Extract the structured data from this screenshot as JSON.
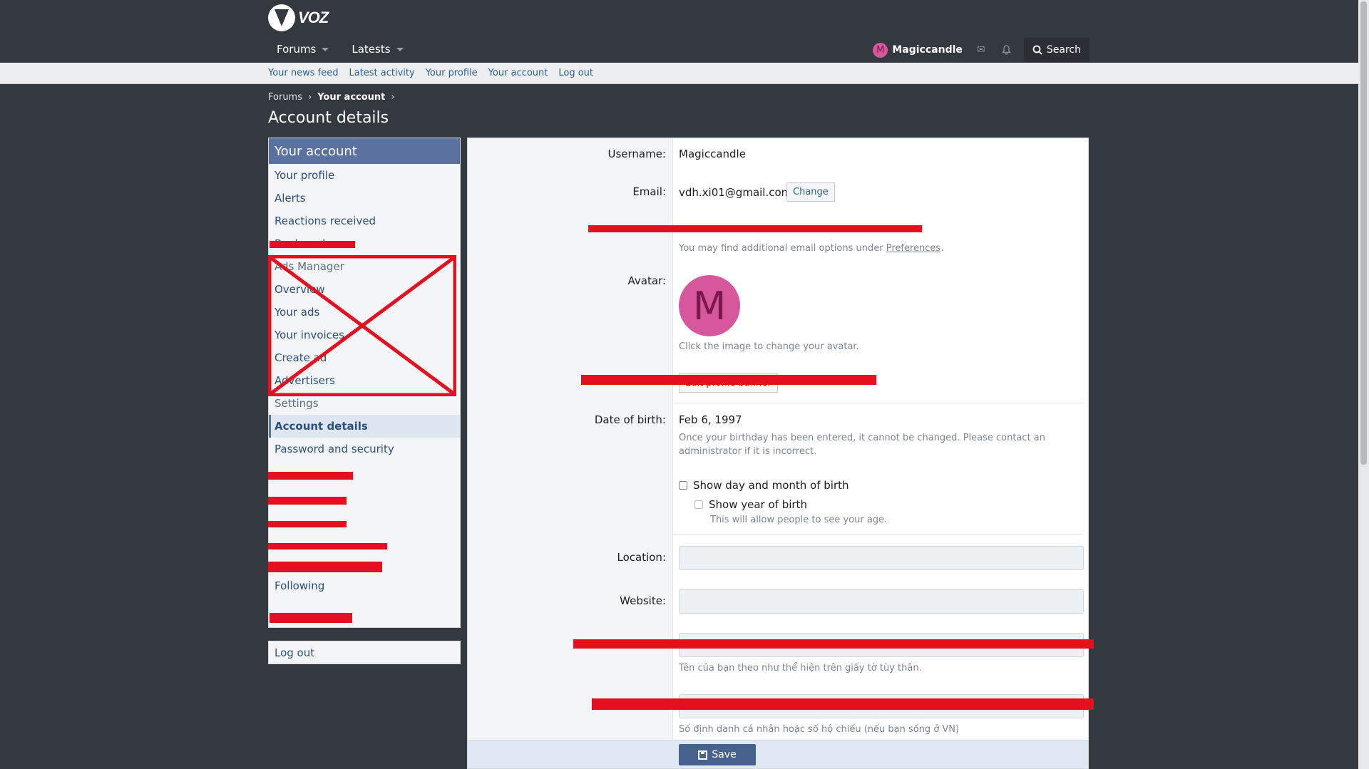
{
  "brand": {
    "logo_text": "VOZ"
  },
  "nav": {
    "forums": "Forums",
    "latests": "Latests"
  },
  "userbar": {
    "avatar_letter": "M",
    "username": "Magiccandle",
    "search": "Search"
  },
  "subnav": [
    "Your news feed",
    "Latest activity",
    "Your profile",
    "Your account",
    "Log out"
  ],
  "breadcrumb": {
    "forums": "Forums",
    "your_account": "Your account"
  },
  "page_title": "Account details",
  "sidebar": {
    "header": "Your account",
    "items": [
      {
        "label": "Your profile"
      },
      {
        "label": "Alerts"
      },
      {
        "label": "Reactions received"
      },
      {
        "label": "Bookmarks"
      },
      {
        "label": "Ads Manager"
      },
      {
        "label": "Overview"
      },
      {
        "label": "Your ads"
      },
      {
        "label": "Your invoices"
      },
      {
        "label": "Create ad"
      },
      {
        "label": "Advertisers"
      },
      {
        "label": "Settings"
      },
      {
        "label": "Account details"
      },
      {
        "label": "Password and security"
      },
      {
        "label": ""
      },
      {
        "label": ""
      },
      {
        "label": ""
      },
      {
        "label": ""
      },
      {
        "label": ""
      },
      {
        "label": "Following"
      },
      {
        "label": ""
      }
    ],
    "logout": "Log out"
  },
  "form": {
    "username_label": "Username:",
    "username_value": "Magiccandle",
    "email_label": "Email:",
    "email_value": "vdh.xi01@gmail.com",
    "change_button": "Change",
    "email_hint_prefix": "You may find additional email options under ",
    "email_hint_link": "Preferences",
    "email_hint_suffix": ".",
    "avatar_label": "Avatar:",
    "avatar_letter": "M",
    "avatar_hint": "Click the image to change your avatar.",
    "dob_label": "Date of birth:",
    "dob_value": "Feb 6, 1997",
    "dob_hint": "Once your birthday has been entered, it cannot be changed. Please contact an administrator if it is incorrect.",
    "show_day_month": "Show day and month of birth",
    "show_year": "Show year of birth",
    "show_year_hint": "This will allow people to see your age.",
    "location_label": "Location:",
    "website_label": "Website:",
    "name_hint": "Tên của bạn theo như thể hiện trên giấy tờ tùy thân.",
    "id_hint": "Số định danh cá nhân hoặc số hộ chiếu (nếu bạn sống ở VN)",
    "save_button": "Save"
  },
  "colors": {
    "background": "#34383f",
    "accent": "#5b72a1",
    "avatar": "#d6579c",
    "redaction": "#e5101f"
  }
}
